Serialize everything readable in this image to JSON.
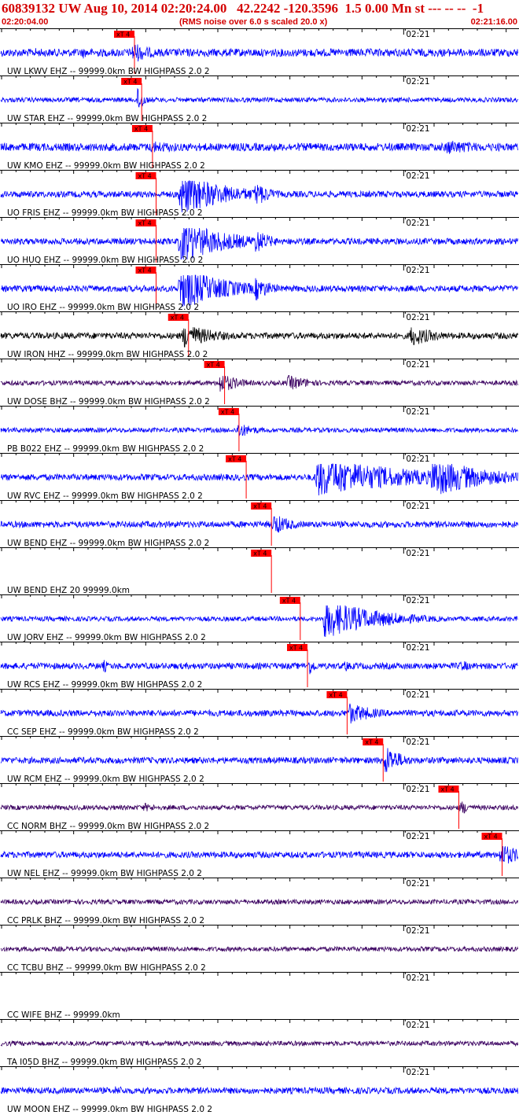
{
  "header": {
    "title": "60839132 UW Aug 10, 2014 02:20:24.00   42.2242 -120.3596  1.5 0.00 Mn st --- -- --  -1",
    "start_time": "02:20:04.00",
    "subtitle": "(RMS noise over 6.0 s scaled 20.0 x)",
    "end_time": "02:21:16.00"
  },
  "colors": {
    "header_text": "#d40000",
    "blue_trace": "#0000ff",
    "black_trace": "#000000",
    "purple_trace": "#3a0060",
    "pick_box": "#ff0000",
    "pick_line": "#ff0000",
    "separator": "#000000"
  },
  "chart_data": {
    "type": "seismogram",
    "x_start": "02:20:04.00",
    "x_end": "02:21:16.00",
    "time_mark_label": "02:21",
    "pick_label": "xT 4",
    "traces": [
      {
        "label": "UW LKWV EHZ -- 99999.0km BW  HIGHPASS  2.0  2",
        "color": "blue",
        "pick_time": 18.0,
        "amp": 5,
        "bursts": [
          {
            "t": 5.0,
            "amp": 7,
            "w": 1.2
          },
          {
            "t": 11.5,
            "amp": 8,
            "w": 1.0
          },
          {
            "t": 18.5,
            "amp": 14,
            "w": 3.0
          }
        ]
      },
      {
        "label": "UW STAR EHZ -- 99999.0km BW  HIGHPASS  2.0  2",
        "color": "blue",
        "pick_time": 19.0,
        "amp": 3,
        "bursts": [
          {
            "t": 19.2,
            "amp": 20,
            "w": 0.8
          }
        ]
      },
      {
        "label": "UW KMO EHZ -- 99999.0km BW  HIGHPASS  2.0  2",
        "color": "blue",
        "pick_time": 20.5,
        "amp": 5,
        "bursts": [
          {
            "t": 21.0,
            "amp": 8,
            "w": 8.0
          },
          {
            "t": 62.0,
            "amp": 10,
            "w": 7.0
          }
        ]
      },
      {
        "label": "UO FRIS EHZ -- 99999.0km BW  HIGHPASS  2.0  2",
        "color": "blue",
        "pick_time": 21.0,
        "amp": 4,
        "bursts": [
          {
            "t": 25.0,
            "amp": 28,
            "w": 7.0
          },
          {
            "t": 35.5,
            "amp": 16,
            "w": 2.5
          }
        ]
      },
      {
        "label": "UO HUQ EHZ -- 99999.0km BW  HIGHPASS  2.0  2",
        "color": "blue",
        "pick_time": 21.0,
        "amp": 4,
        "bursts": [
          {
            "t": 25.0,
            "amp": 28,
            "w": 7.0
          },
          {
            "t": 35.5,
            "amp": 16,
            "w": 2.5
          }
        ]
      },
      {
        "label": "UO IRO EHZ -- 99999.0km BW  HIGHPASS  2.0  2",
        "color": "blue",
        "pick_time": 21.0,
        "amp": 4,
        "bursts": [
          {
            "t": 25.0,
            "amp": 28,
            "w": 7.0
          },
          {
            "t": 35.5,
            "amp": 16,
            "w": 2.5
          }
        ]
      },
      {
        "label": "UW IRON HHZ -- 99999.0km BW  HIGHPASS  2.0  2",
        "color": "black",
        "pick_time": 25.5,
        "amp": 4,
        "bursts": [
          {
            "t": 25.5,
            "amp": 16,
            "w": 5.0
          },
          {
            "t": 57.0,
            "amp": 14,
            "w": 4.0
          }
        ]
      },
      {
        "label": "UW DOSE BHZ -- 99999.0km BW  HIGHPASS  2.0  2",
        "color": "purple",
        "pick_time": 30.5,
        "amp": 3,
        "bursts": [
          {
            "t": 30.5,
            "amp": 14,
            "w": 3.0
          },
          {
            "t": 40.0,
            "amp": 10,
            "w": 4.0
          }
        ]
      },
      {
        "label": "PB B022 EHZ -- 99999.0km BW  HIGHPASS  2.0  2",
        "color": "blue",
        "pick_time": 32.5,
        "amp": 3,
        "bursts": [
          {
            "t": 33.0,
            "amp": 10,
            "w": 3.0
          }
        ]
      },
      {
        "label": "UW RVC EHZ -- 99999.0km BW  HIGHPASS  2.0  2",
        "color": "blue",
        "pick_time": 33.5,
        "amp": 4,
        "bursts": [
          {
            "t": 44.0,
            "amp": 26,
            "w": 14.0
          },
          {
            "t": 60.0,
            "amp": 26,
            "w": 8.0
          }
        ]
      },
      {
        "label": "UW BEND EHZ -- 99999.0km BW  HIGHPASS  2.0  2",
        "color": "blue",
        "pick_time": 37.0,
        "amp": 4,
        "bursts": [
          {
            "t": 38.0,
            "amp": 14,
            "w": 3.0
          }
        ]
      },
      {
        "label": "UW BEND EHZ 20 99999.0km",
        "color": "blue",
        "pick_time": 37.0,
        "amp": 0,
        "bursts": []
      },
      {
        "label": "UW JORV EHZ -- 99999.0km BW  HIGHPASS  2.0  2",
        "color": "blue",
        "pick_time": 41.0,
        "amp": 3,
        "bursts": [
          {
            "t": 45.0,
            "amp": 26,
            "w": 8.0
          }
        ]
      },
      {
        "label": "UW RCS EHZ -- 99999.0km BW  HIGHPASS  2.0  2",
        "color": "blue",
        "pick_time": 42.0,
        "amp": 4,
        "bursts": [
          {
            "t": 14.5,
            "amp": 10,
            "w": 0.5
          },
          {
            "t": 43.0,
            "amp": 12,
            "w": 1.0
          },
          {
            "t": 48.0,
            "amp": 10,
            "w": 0.5
          },
          {
            "t": 64.0,
            "amp": 8,
            "w": 2.0
          }
        ]
      },
      {
        "label": "CC SEP EHZ -- 99999.0km BW  HIGHPASS  2.0  2",
        "color": "blue",
        "pick_time": 47.5,
        "amp": 4,
        "bursts": [
          {
            "t": 48.5,
            "amp": 14,
            "w": 4.0
          }
        ]
      },
      {
        "label": "UW RCM EHZ -- 99999.0km BW  HIGHPASS  2.0  2",
        "color": "blue",
        "pick_time": 52.5,
        "amp": 4,
        "bursts": [
          {
            "t": 53.5,
            "amp": 20,
            "w": 2.5
          }
        ]
      },
      {
        "label": "CC NORM BHZ -- 99999.0km BW  HIGHPASS  2.0  2",
        "color": "purple",
        "pick_time": 63.0,
        "amp": 3,
        "bursts": [
          {
            "t": 20.0,
            "amp": 6,
            "w": 3.0
          },
          {
            "t": 64.0,
            "amp": 10,
            "w": 1.5
          }
        ]
      },
      {
        "label": "UW NEL EHZ -- 99999.0km BW  HIGHPASS  2.0  2",
        "color": "blue",
        "pick_time": 69.0,
        "amp": 4,
        "bursts": [
          {
            "t": 69.5,
            "amp": 16,
            "w": 3.0
          }
        ]
      },
      {
        "label": "CC PRLK BHZ -- 99999.0km BW  HIGHPASS  2.0  2",
        "color": "purple",
        "pick_time": null,
        "amp": 3,
        "bursts": []
      },
      {
        "label": "CC TCBU BHZ -- 99999.0km BW  HIGHPASS  2.0  2",
        "color": "purple",
        "pick_time": null,
        "amp": 3,
        "bursts": []
      },
      {
        "label": "CC WIFE BHZ -- 99999.0km",
        "color": "blue",
        "pick_time": null,
        "amp": 0,
        "bursts": []
      },
      {
        "label": "TA I05D BHZ -- 99999.0km BW  HIGHPASS  2.0  2",
        "color": "purple",
        "pick_time": null,
        "amp": 3,
        "bursts": []
      },
      {
        "label": "UW MOON EHZ -- 99999.0km BW  HIGHPASS  2.0  2",
        "color": "blue",
        "pick_time": null,
        "amp": 4,
        "bursts": [
          {
            "t": 16.0,
            "amp": 6,
            "w": 4.0
          }
        ]
      }
    ]
  }
}
